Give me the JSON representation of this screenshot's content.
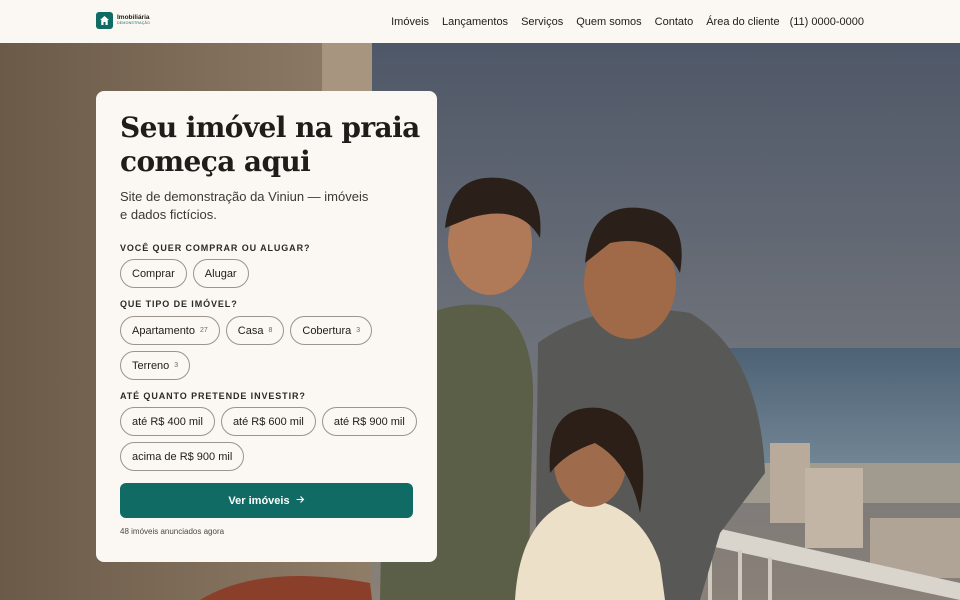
{
  "brand": {
    "name": "Imobiliária",
    "tagline": "DEMONSTRAÇÃO",
    "icon": "house-icon"
  },
  "nav": {
    "items": [
      "Imóveis",
      "Lançamentos",
      "Serviços",
      "Quem somos",
      "Contato",
      "Área do cliente"
    ],
    "phone": "(11) 0000-0000"
  },
  "hero": {
    "title": "Seu imóvel na praia começa aqui",
    "subtitle": "Site de demonstração da Viniun — imóveis e dados fictícios."
  },
  "filters": {
    "deal": {
      "label": "Você quer comprar ou alugar?",
      "options": [
        {
          "label": "Comprar"
        },
        {
          "label": "Alugar"
        }
      ]
    },
    "type": {
      "label": "Que tipo de imóvel?",
      "options": [
        {
          "label": "Apartamento",
          "count": "27"
        },
        {
          "label": "Casa",
          "count": "8"
        },
        {
          "label": "Cobertura",
          "count": "3"
        },
        {
          "label": "Terreno",
          "count": "3"
        }
      ]
    },
    "budget": {
      "label": "Até quanto pretende investir?",
      "options": [
        {
          "label": "até R$ 400 mil"
        },
        {
          "label": "até R$ 600 mil"
        },
        {
          "label": "até R$ 900 mil"
        },
        {
          "label": "acima de R$ 900 mil"
        }
      ]
    }
  },
  "cta": {
    "label": "Ver imóveis",
    "icon": "arrow-right-icon"
  },
  "footnote": "48 imóveis anunciados agora",
  "colors": {
    "accent": "#0f6b64",
    "background": "#fbf7f3",
    "chip_border": "#9c958d"
  }
}
